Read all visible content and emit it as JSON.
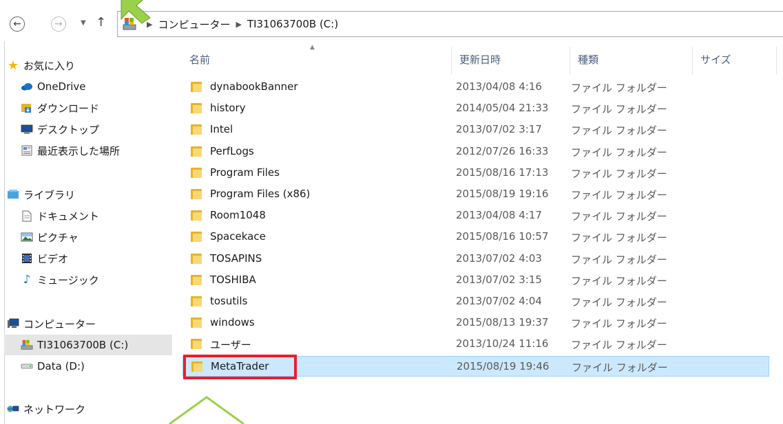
{
  "address": {
    "crumbs": [
      "コンピューター",
      "TI31063700B (C:)"
    ]
  },
  "nav": {
    "back_icon": "back-arrow-icon",
    "forward_icon": "forward-arrow-icon",
    "up_icon": "up-arrow-icon"
  },
  "sidebar": {
    "favorites": {
      "label": "お気に入り",
      "items": [
        {
          "label": "OneDrive",
          "icon": "onedrive-icon"
        },
        {
          "label": "ダウンロード",
          "icon": "downloads-icon"
        },
        {
          "label": "デスクトップ",
          "icon": "desktop-icon"
        },
        {
          "label": "最近表示した場所",
          "icon": "recent-places-icon"
        }
      ]
    },
    "libraries": {
      "label": "ライブラリ",
      "items": [
        {
          "label": "ドキュメント",
          "icon": "documents-icon"
        },
        {
          "label": "ピクチャ",
          "icon": "pictures-icon"
        },
        {
          "label": "ビデオ",
          "icon": "videos-icon"
        },
        {
          "label": "ミュージック",
          "icon": "music-icon"
        }
      ]
    },
    "computer": {
      "label": "コンピューター",
      "items": [
        {
          "label": "TI31063700B (C:)",
          "icon": "drive-c-icon",
          "selected": true
        },
        {
          "label": "Data (D:)",
          "icon": "drive-d-icon"
        }
      ]
    },
    "network": {
      "label": "ネットワーク",
      "icon": "network-icon"
    }
  },
  "columns": {
    "name": "名前",
    "date": "更新日時",
    "type": "種類",
    "size": "サイズ"
  },
  "files": [
    {
      "name": "dynabookBanner",
      "date": "2013/04/08 4:16",
      "type": "ファイル フォルダー"
    },
    {
      "name": "history",
      "date": "2014/05/04 21:33",
      "type": "ファイル フォルダー"
    },
    {
      "name": "Intel",
      "date": "2013/07/02 3:17",
      "type": "ファイル フォルダー"
    },
    {
      "name": "PerfLogs",
      "date": "2012/07/26 16:33",
      "type": "ファイル フォルダー"
    },
    {
      "name": "Program Files",
      "date": "2015/08/16 17:13",
      "type": "ファイル フォルダー"
    },
    {
      "name": "Program Files (x86)",
      "date": "2015/08/19 19:16",
      "type": "ファイル フォルダー"
    },
    {
      "name": "Room1048",
      "date": "2013/04/08 4:17",
      "type": "ファイル フォルダー"
    },
    {
      "name": "Spacekace",
      "date": "2015/08/16 10:57",
      "type": "ファイル フォルダー"
    },
    {
      "name": "TOSAPINS",
      "date": "2013/07/02 4:03",
      "type": "ファイル フォルダー"
    },
    {
      "name": "TOSHIBA",
      "date": "2013/07/02 3:15",
      "type": "ファイル フォルダー"
    },
    {
      "name": "tosutils",
      "date": "2013/07/02 4:04",
      "type": "ファイル フォルダー"
    },
    {
      "name": "windows",
      "date": "2015/08/13 19:37",
      "type": "ファイル フォルダー"
    },
    {
      "name": "ユーザー",
      "date": "2013/10/24 11:16",
      "type": "ファイル フォルダー"
    },
    {
      "name": "MetaTrader",
      "date": "2015/08/19 19:46",
      "type": "ファイル フォルダー",
      "selected": true
    }
  ],
  "colors": {
    "selection_bg": "#cce8ff",
    "selection_border": "#99d1ff",
    "highlight_red": "#e8202a",
    "annotation_green": "#9ad14b",
    "header_text": "#4c607a"
  }
}
